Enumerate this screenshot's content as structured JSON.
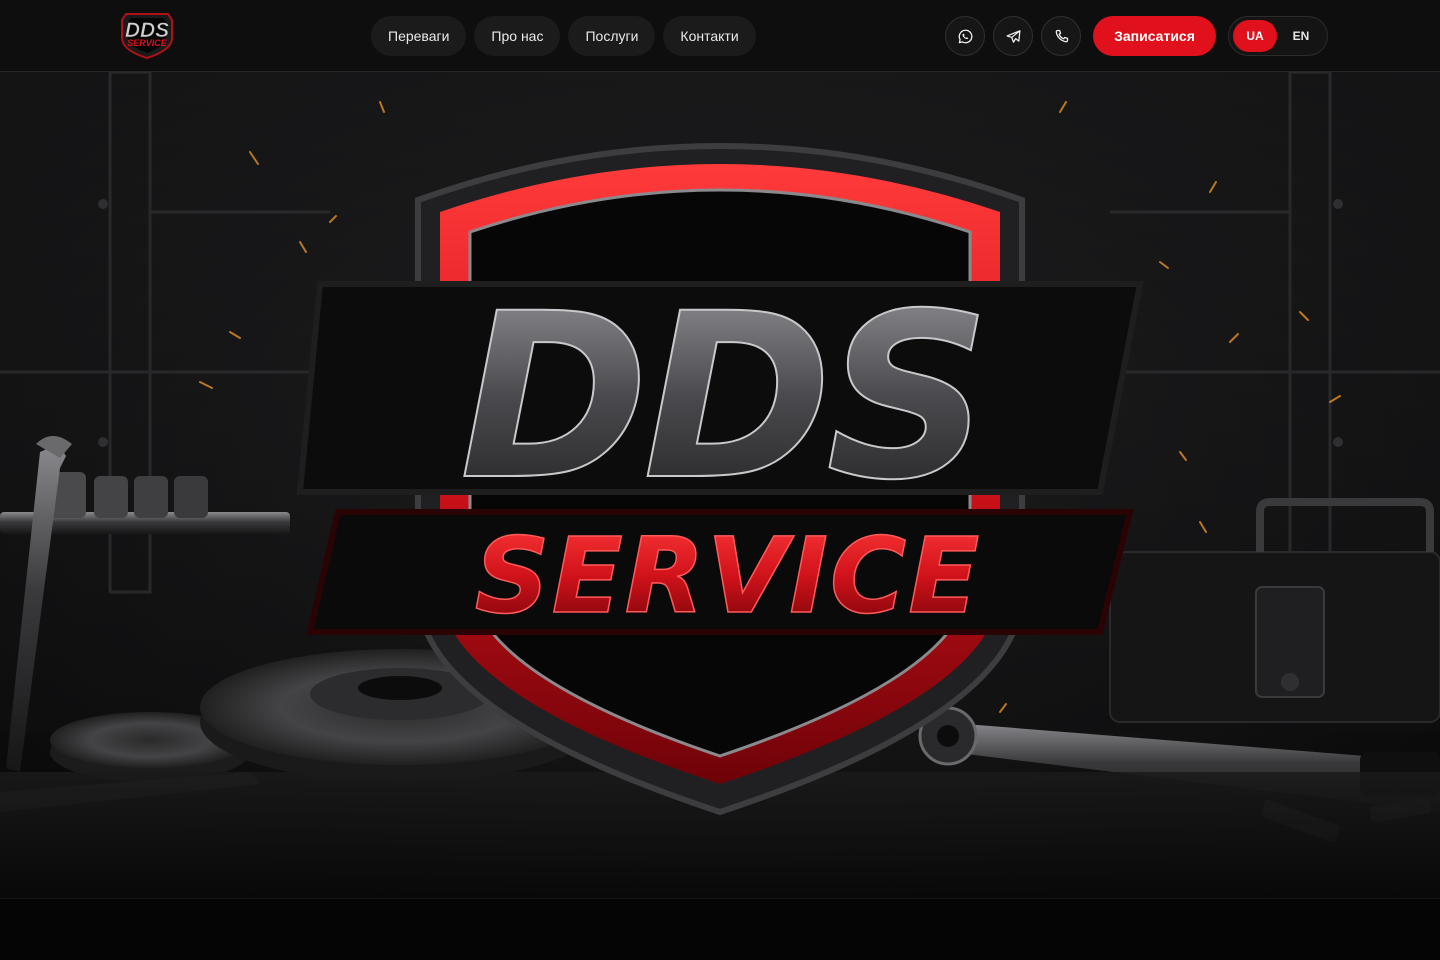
{
  "brand": {
    "logo_line1": "DDS",
    "logo_line2": "SERVICE",
    "accent_color": "#e0101c"
  },
  "nav": {
    "items": [
      {
        "label": "Переваги"
      },
      {
        "label": "Про нас"
      },
      {
        "label": "Послуги"
      },
      {
        "label": "Контакти"
      }
    ]
  },
  "contacts": {
    "icons": [
      "whatsapp-icon",
      "telegram-icon",
      "phone-icon"
    ]
  },
  "cta": {
    "label": "Записатися"
  },
  "language": {
    "options": [
      "UA",
      "EN"
    ],
    "selected": "UA"
  },
  "hero": {
    "logo_line1": "DDS",
    "logo_line2": "SERVICE"
  }
}
